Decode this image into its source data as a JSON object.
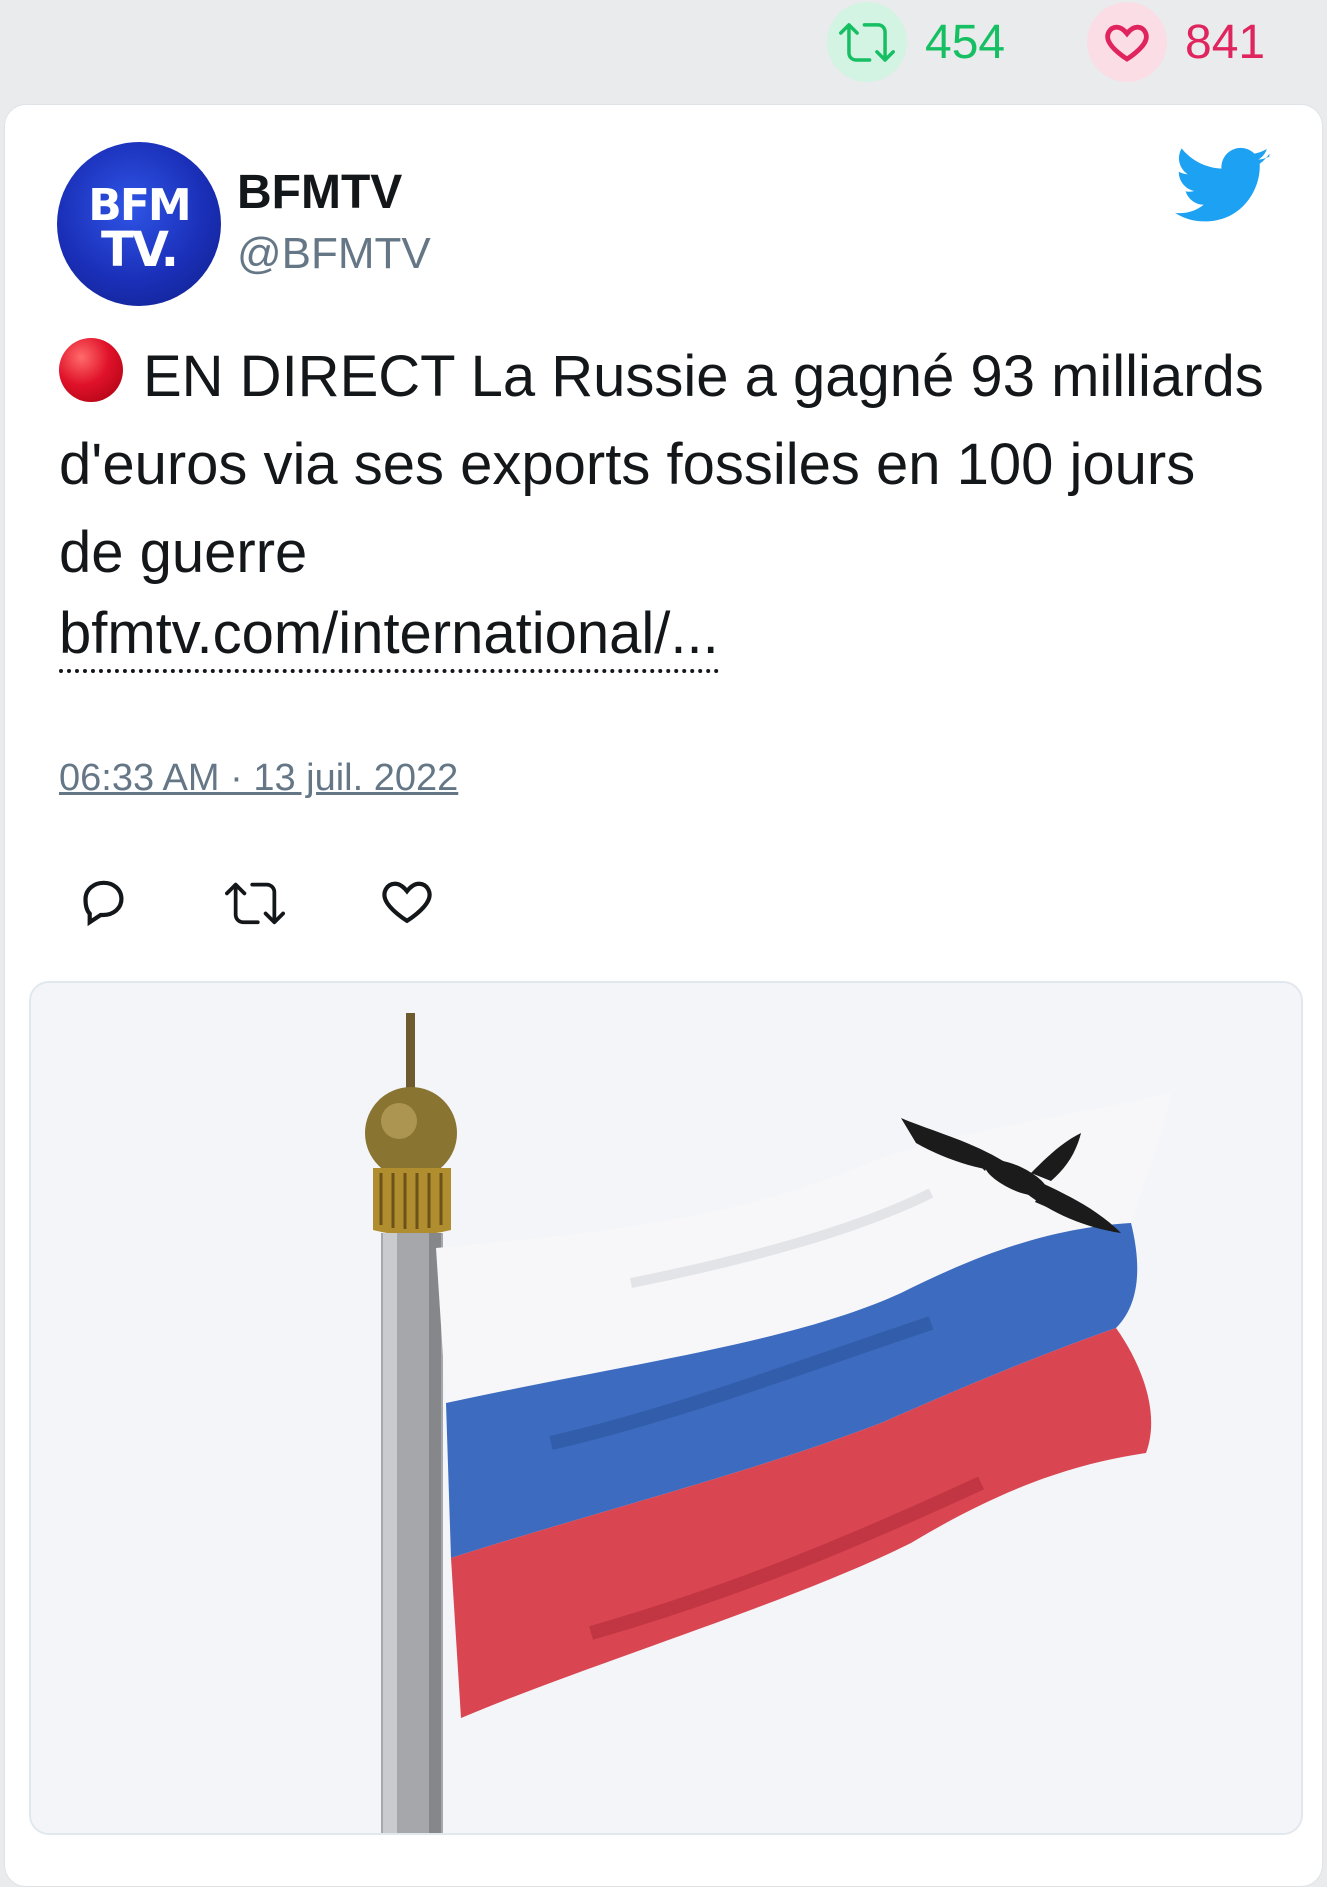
{
  "stats": {
    "retweet_count": "454",
    "like_count": "841",
    "retweet_icon": "retweet-icon",
    "like_icon": "heart-icon"
  },
  "tweet": {
    "display_name": "BFMTV",
    "handle": "@BFMTV",
    "avatar": {
      "line1": "BFM",
      "line2": "TV."
    },
    "text": "EN DIRECT La Russie a gagné 93 milliards d'euros via ses exports fossiles en 100 jours de guerre",
    "link": "bfmtv.com/international/...",
    "timestamp": "06:33 AM · 13 juil. 2022",
    "status_icon": "red-circle-emoji"
  },
  "actions": [
    "reply-icon",
    "retweet-icon",
    "like-icon"
  ],
  "colors": {
    "retweet": "#17bf63",
    "like": "#e0245e",
    "twitter_blue": "#1da1f2",
    "muted_text": "#657786"
  },
  "media": {
    "subject": "photo"
  }
}
